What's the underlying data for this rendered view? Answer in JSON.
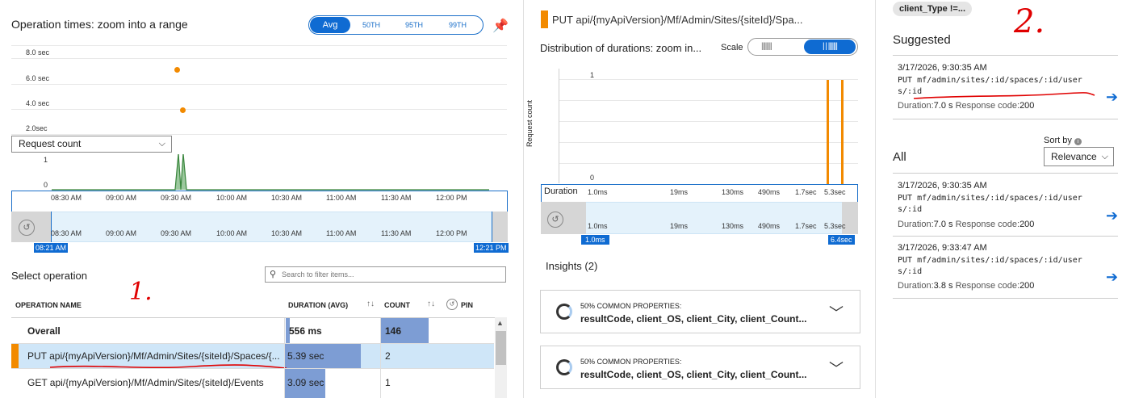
{
  "left": {
    "title": "Operation times: zoom into a range",
    "percentile_tabs": [
      "Avg",
      "50TH",
      "95TH",
      "99TH"
    ],
    "y_labels": [
      "8.0 sec",
      "6.0 sec",
      "4.0 sec",
      "2.0sec"
    ],
    "metric_select": "Request count",
    "count_axis": [
      "1",
      "0"
    ],
    "time_ticks": [
      "08:30 AM",
      "09:00 AM",
      "09:30 AM",
      "10:00 AM",
      "10:30 AM",
      "11:00 AM",
      "11:30 AM",
      "12:00 PM"
    ],
    "range_start": "08:21 AM",
    "range_end": "12:21 PM",
    "select_operation": "Select operation",
    "search_placeholder": "Search to filter items...",
    "annotation": "1.",
    "columns": [
      "OPERATION NAME",
      "DURATION (AVG)",
      "COUNT",
      "PIN"
    ],
    "rows": [
      {
        "name": "Overall",
        "duration": "556 ms",
        "count": "146",
        "duration_fraction": 0.01,
        "count_fraction": 1.0
      },
      {
        "name": "PUT api/{myApiVersion}/Mf/Admin/Sites/{siteId}/Spaces/{...",
        "duration": "5.39 sec",
        "count": "2",
        "duration_fraction": 0.96,
        "count_fraction": 0.0
      },
      {
        "name": "GET api/{myApiVersion}/Mf/Admin/Sites/{siteId}/Events",
        "duration": "3.09 sec",
        "count": "1",
        "duration_fraction": 0.55,
        "count_fraction": 0.0
      }
    ]
  },
  "middle": {
    "op_title": "PUT api/{myApiVersion}/Mf/Admin/Sites/{siteId}/Spa...",
    "dist_title": "Distribution of durations: zoom in...",
    "scale_label": "Scale",
    "y_axis_label": "Request count",
    "y_ticks": [
      "1",
      "0"
    ],
    "duration_label": "Duration",
    "duration_ticks": [
      "1.0ms",
      "19ms",
      "130ms",
      "490ms",
      "1.7sec",
      "5.3sec"
    ],
    "range_start": "1.0ms",
    "range_end": "6.4sec",
    "insights_title": "Insights (2)",
    "insights": [
      {
        "heading": "50% COMMON PROPERTIES:",
        "text": "resultCode, client_OS, client_City, client_Count..."
      },
      {
        "heading": "50% COMMON PROPERTIES:",
        "text": "resultCode, client_OS, client_City, client_Count..."
      }
    ]
  },
  "right": {
    "filter_pill": "client_Type !=...",
    "annotation": "2.",
    "suggested_title": "Suggested",
    "sort_label": "Sort by",
    "sort_value": "Relevance",
    "all_title": "All",
    "suggested": [
      {
        "time": "3/17/2026, 9:30:35 AM",
        "line1": "PUT mf/admin/sites/:id/spaces/:id/user",
        "line2": "s/:id",
        "duration_label": "Duration:",
        "duration": "7.0 s",
        "code_label": "Response code:",
        "code": "200"
      }
    ],
    "all": [
      {
        "time": "3/17/2026, 9:30:35 AM",
        "line1": "PUT mf/admin/sites/:id/spaces/:id/user",
        "line2": "s/:id",
        "duration_label": "Duration:",
        "duration": "7.0 s",
        "code_label": "Response code:",
        "code": "200"
      },
      {
        "time": "3/17/2026, 9:33:47 AM",
        "line1": "PUT mf/admin/sites/:id/spaces/:id/user",
        "line2": "s/:id",
        "duration_label": "Duration:",
        "duration": "3.8 s",
        "code_label": "Response code:",
        "code": "200"
      }
    ]
  },
  "colors": {
    "accent": "#0f6bd2",
    "orange": "#f28a00",
    "green": "#2e7d32",
    "bar": "#7d9dd4",
    "annotation": "#e00000"
  }
}
